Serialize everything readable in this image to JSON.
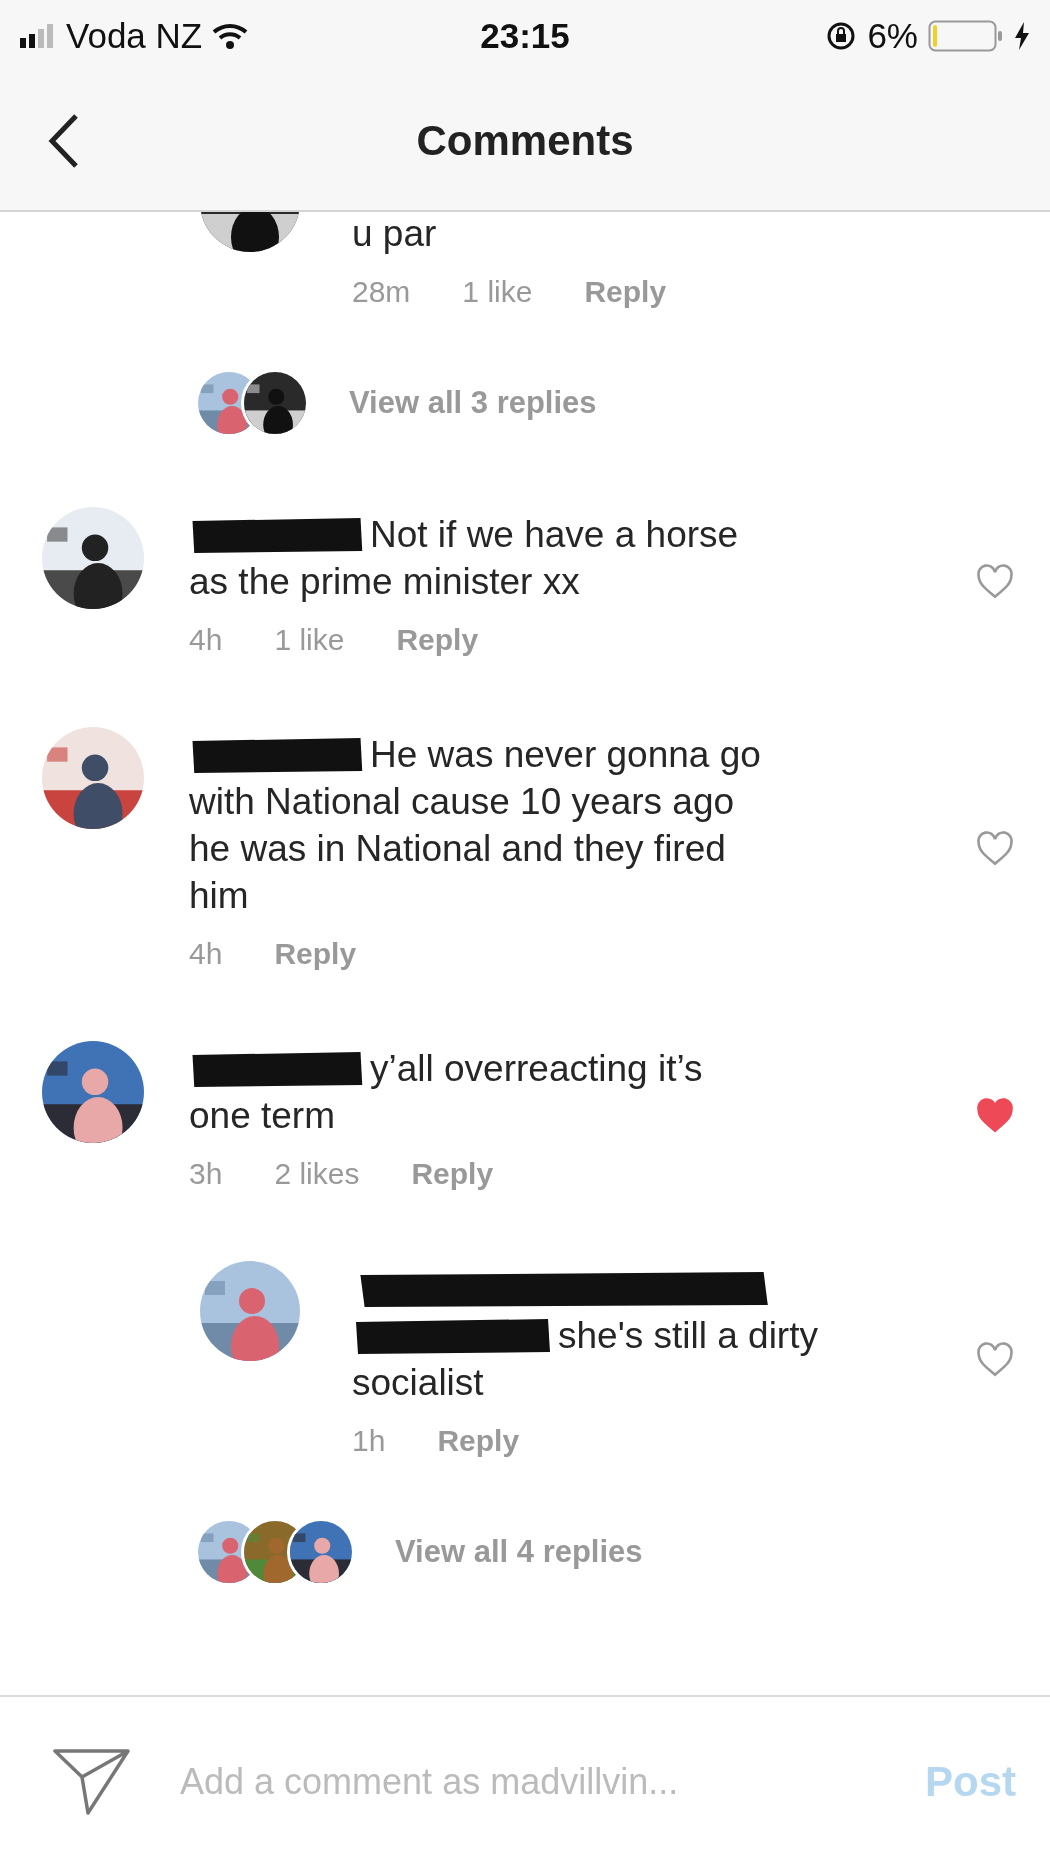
{
  "status_bar": {
    "carrier": "Voda NZ",
    "time": "23:15",
    "battery": "6%"
  },
  "header": {
    "title": "Comments"
  },
  "items": [
    {
      "kind": "reply",
      "text": "u par",
      "meta": [
        "28m",
        "1 like",
        "Reply"
      ]
    },
    {
      "kind": "replies",
      "label": "View all 3 replies"
    },
    {
      "kind": "redacted_comment",
      "text": "Not if we have a horse as the prime minister xx",
      "meta": [
        "4h",
        "1 like",
        "Reply"
      ],
      "liked": false
    },
    {
      "kind": "redacted_comment",
      "text": "He was never gonna go with National cause 10 years ago he was in National and they fired him",
      "meta": [
        "4h",
        "Reply"
      ],
      "liked": false
    },
    {
      "kind": "redacted_comment",
      "text": "y’all overreacting it’s one term",
      "meta": [
        "3h",
        "2 likes",
        "Reply"
      ],
      "liked": true
    },
    {
      "kind": "redacted_reply",
      "text": "she's still a dirty socialist",
      "meta": [
        "1h",
        "Reply"
      ],
      "liked": false
    },
    {
      "kind": "replies",
      "label": "View all 4 replies"
    }
  ],
  "composer": {
    "placeholder": "Add a comment as madvillvin...",
    "post": "Post"
  }
}
